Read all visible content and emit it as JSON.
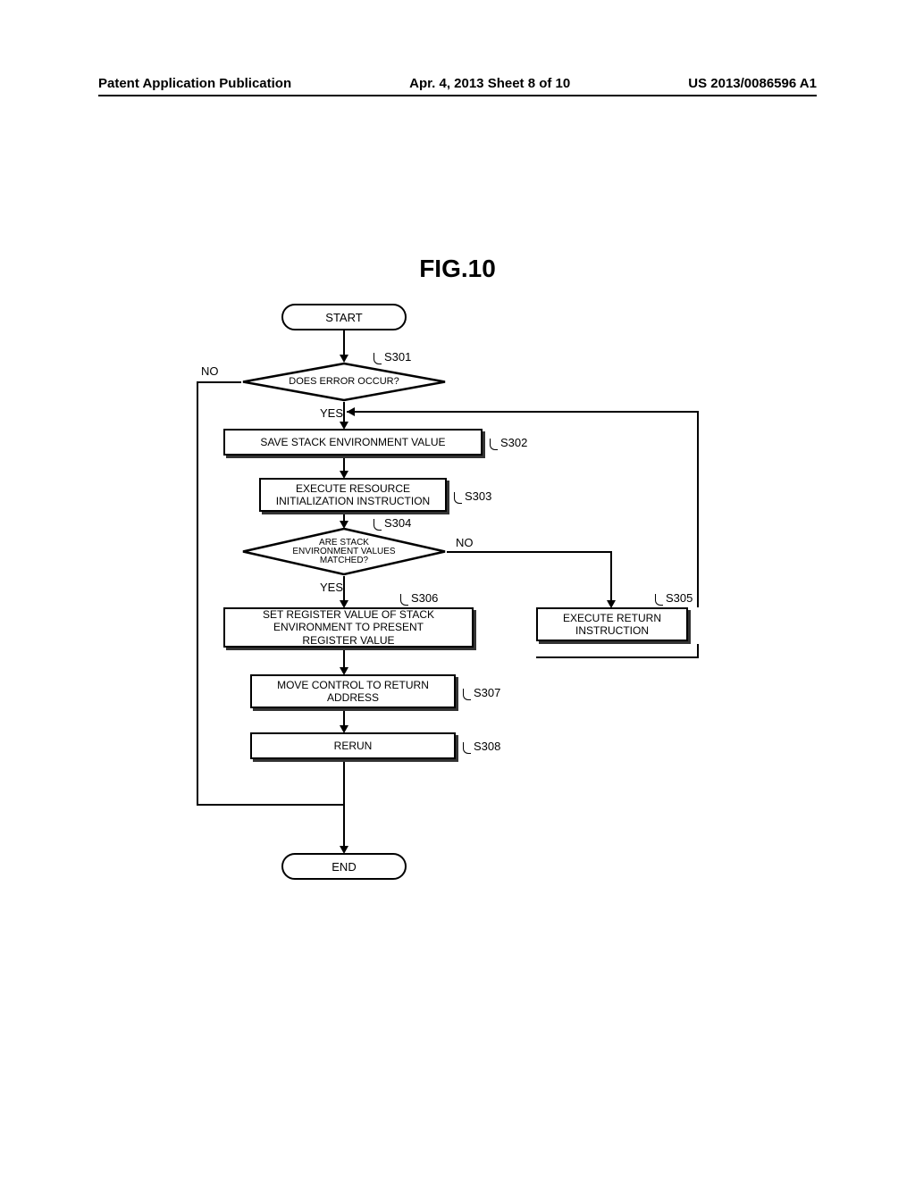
{
  "header": {
    "left": "Patent Application Publication",
    "center": "Apr. 4, 2013  Sheet 8 of 10",
    "right": "US 2013/0086596 A1"
  },
  "figure_title": "FIG.10",
  "flowchart": {
    "start": "START",
    "end": "END",
    "decision1": "DOES ERROR OCCUR?",
    "decision2": "ARE STACK\nENVIRONMENT VALUES\nMATCHED?",
    "process1": "SAVE STACK ENVIRONMENT VALUE",
    "process2": "EXECUTE RESOURCE\nINITIALIZATION INSTRUCTION",
    "process3": "SET REGISTER VALUE OF STACK\nENVIRONMENT TO PRESENT\nREGISTER VALUE",
    "process4": "MOVE CONTROL TO RETURN\nADDRESS",
    "process5": "RERUN",
    "process6": "EXECUTE RETURN\nINSTRUCTION",
    "labels": {
      "no1": "NO",
      "yes1": "YES",
      "no2": "NO",
      "yes2": "YES",
      "s301": "S301",
      "s302": "S302",
      "s303": "S303",
      "s304": "S304",
      "s305": "S305",
      "s306": "S306",
      "s307": "S307",
      "s308": "S308"
    }
  }
}
